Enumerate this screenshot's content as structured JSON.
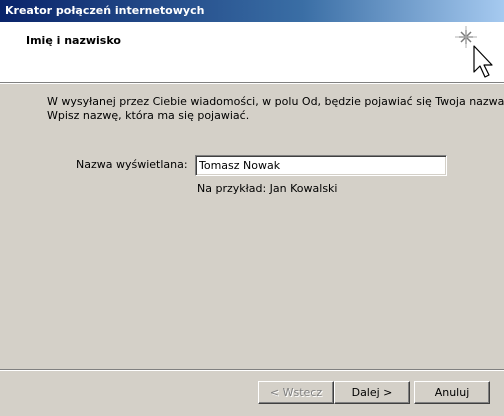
{
  "window": {
    "title": "Kreator połączeń internetowych"
  },
  "header": {
    "title": "Imię i nazwisko",
    "icon": "wizard-sparkle-cursor-icon"
  },
  "body": {
    "instruction_line1": "W wysyłanej przez Ciebie wiadomości, w polu Od, będzie pojawiać się Twoja nazwa.",
    "instruction_line2": "Wpisz nazwę, która ma się pojawiać.",
    "display_name_label": "Nazwa wyświetlana:",
    "display_name_value": "Tomasz Nowak",
    "example_text": "Na przykład: Jan Kowalski"
  },
  "buttons": {
    "back": "< Wstecz",
    "next": "Dalej >",
    "cancel": "Anuluj"
  }
}
